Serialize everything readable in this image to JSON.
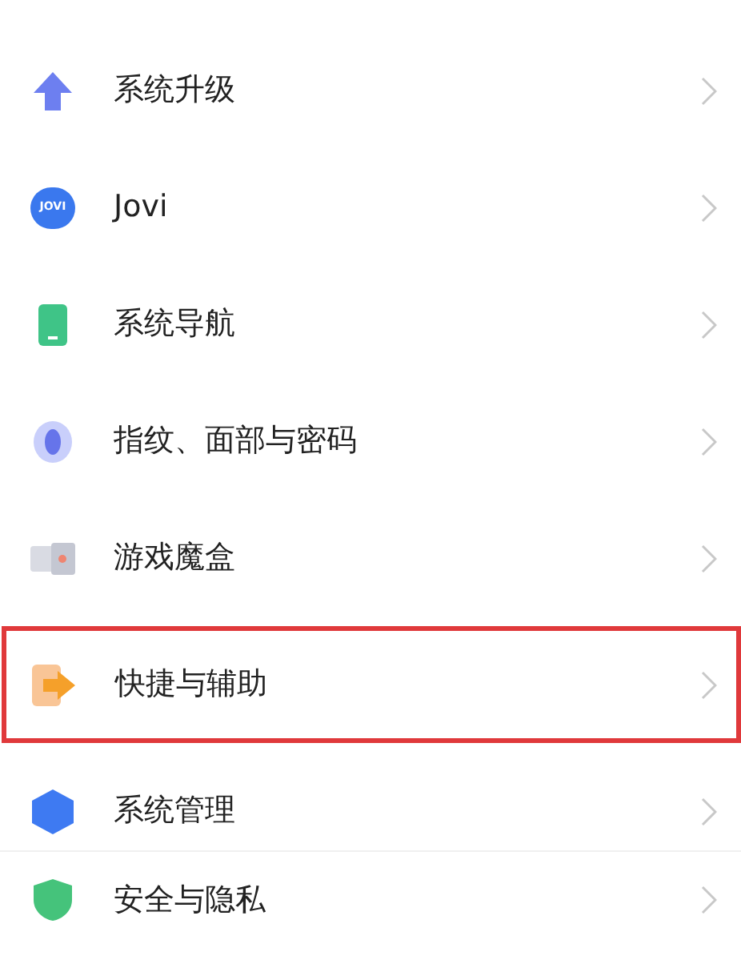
{
  "groups": [
    {
      "items": [
        {
          "label": "系统升级",
          "kind": "upgrade",
          "highlighted": false
        },
        {
          "label": "Jovi",
          "kind": "jovi",
          "icon_text": "JOVI",
          "highlighted": false
        },
        {
          "label": "系统导航",
          "kind": "phone",
          "highlighted": false
        },
        {
          "label": "指纹、面部与密码",
          "kind": "fingerprint",
          "highlighted": false
        },
        {
          "label": "游戏魔盒",
          "kind": "gamebox",
          "highlighted": false
        },
        {
          "label": "快捷与辅助",
          "kind": "shortcut",
          "highlighted": true
        },
        {
          "label": "系统管理",
          "kind": "hexagon",
          "highlighted": false
        }
      ]
    },
    {
      "items": [
        {
          "label": "安全与隐私",
          "kind": "shield",
          "highlighted": false
        }
      ]
    }
  ]
}
